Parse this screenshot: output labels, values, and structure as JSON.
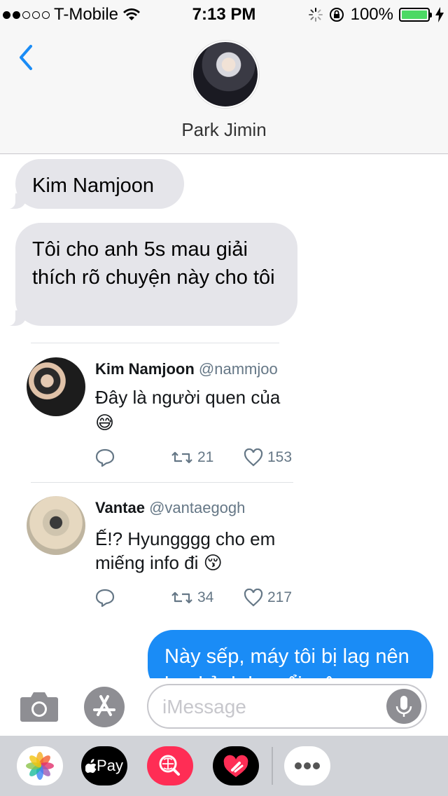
{
  "status_bar": {
    "carrier": "T-Mobile",
    "time": "7:13 PM",
    "battery": "100%",
    "signal_bars": 2,
    "colors": {
      "battery_fill": "#4cd964"
    }
  },
  "header": {
    "contact_name": "Park Jimin",
    "back_icon": "chevron-left-icon",
    "accent": "#1a8cf6"
  },
  "messages": [
    {
      "direction": "received",
      "text": "Kim Namjoon"
    },
    {
      "direction": "received",
      "text": "Tôi cho anh 5s mau giải thích rõ chuyện này cho tôi"
    },
    {
      "direction": "sent",
      "text": "Này sếp, máy tôi bị lag nên load ảnh ko nổi, cậu"
    }
  ],
  "tweets": [
    {
      "name": "Kim Namjoon",
      "handle": "@nammjoo",
      "text_line1": "Đây là người quen của",
      "emoji": "😅",
      "retweets": "21",
      "likes": "153"
    },
    {
      "name": "Vantae",
      "handle": "@vantaegogh",
      "text_line1": "Ế!? Hyungggg cho em",
      "text_line2": "miếng info đi",
      "emoji": "😚",
      "retweets": "34",
      "likes": "217"
    }
  ],
  "input": {
    "placeholder": "iMessage"
  },
  "app_drawer": {
    "apps": [
      "photos-icon",
      "apple-pay-icon",
      "images-search-icon",
      "digital-touch-icon",
      "more-icon"
    ],
    "apple_pay_label": "Pay"
  }
}
